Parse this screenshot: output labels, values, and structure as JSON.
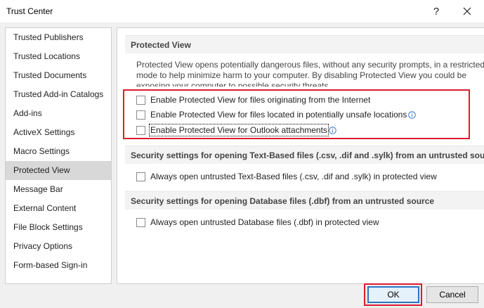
{
  "window": {
    "title": "Trust Center",
    "help_label": "?",
    "close_icon": "close-icon"
  },
  "sidebar": {
    "items": [
      {
        "label": "Trusted Publishers"
      },
      {
        "label": "Trusted Locations"
      },
      {
        "label": "Trusted Documents"
      },
      {
        "label": "Trusted Add-in Catalogs"
      },
      {
        "label": "Add-ins"
      },
      {
        "label": "ActiveX Settings"
      },
      {
        "label": "Macro Settings"
      },
      {
        "label": "Protected View",
        "selected": true
      },
      {
        "label": "Message Bar"
      },
      {
        "label": "External Content"
      },
      {
        "label": "File Block Settings"
      },
      {
        "label": "Privacy Options"
      },
      {
        "label": "Form-based Sign-in"
      }
    ]
  },
  "protected_view": {
    "heading": "Protected View",
    "description": [
      "Protected View opens potentially dangerous files, without any security prompts, in a restricted",
      "mode to help minimize harm to your computer. By disabling Protected View you could be",
      "exposing your computer to possible security threats."
    ],
    "options": [
      {
        "label": "Enable Protected View for files originating from the Internet",
        "checked": false,
        "info": false
      },
      {
        "label": "Enable Protected View for files located in potentially unsafe locations",
        "checked": false,
        "info": true
      },
      {
        "label": "Enable Protected View for Outlook attachments",
        "checked": false,
        "info": true
      }
    ]
  },
  "text_based": {
    "heading": "Security settings for opening Text-Based files (.csv, .dif and .sylk) from an untrusted source",
    "option": {
      "label": "Always open untrusted Text-Based files (.csv, .dif and .sylk) in protected view",
      "checked": false
    }
  },
  "database": {
    "heading": "Security settings for opening Database files (.dbf) from an untrusted source",
    "option": {
      "label": "Always open untrusted Database files (.dbf) in protected view",
      "checked": false
    }
  },
  "buttons": {
    "ok": "OK",
    "cancel": "Cancel"
  },
  "colors": {
    "highlight": "#dc1c2e",
    "selected_item": "#d8d8d8",
    "ok_border": "#2b74c7",
    "info_icon": "#3a78c9"
  }
}
